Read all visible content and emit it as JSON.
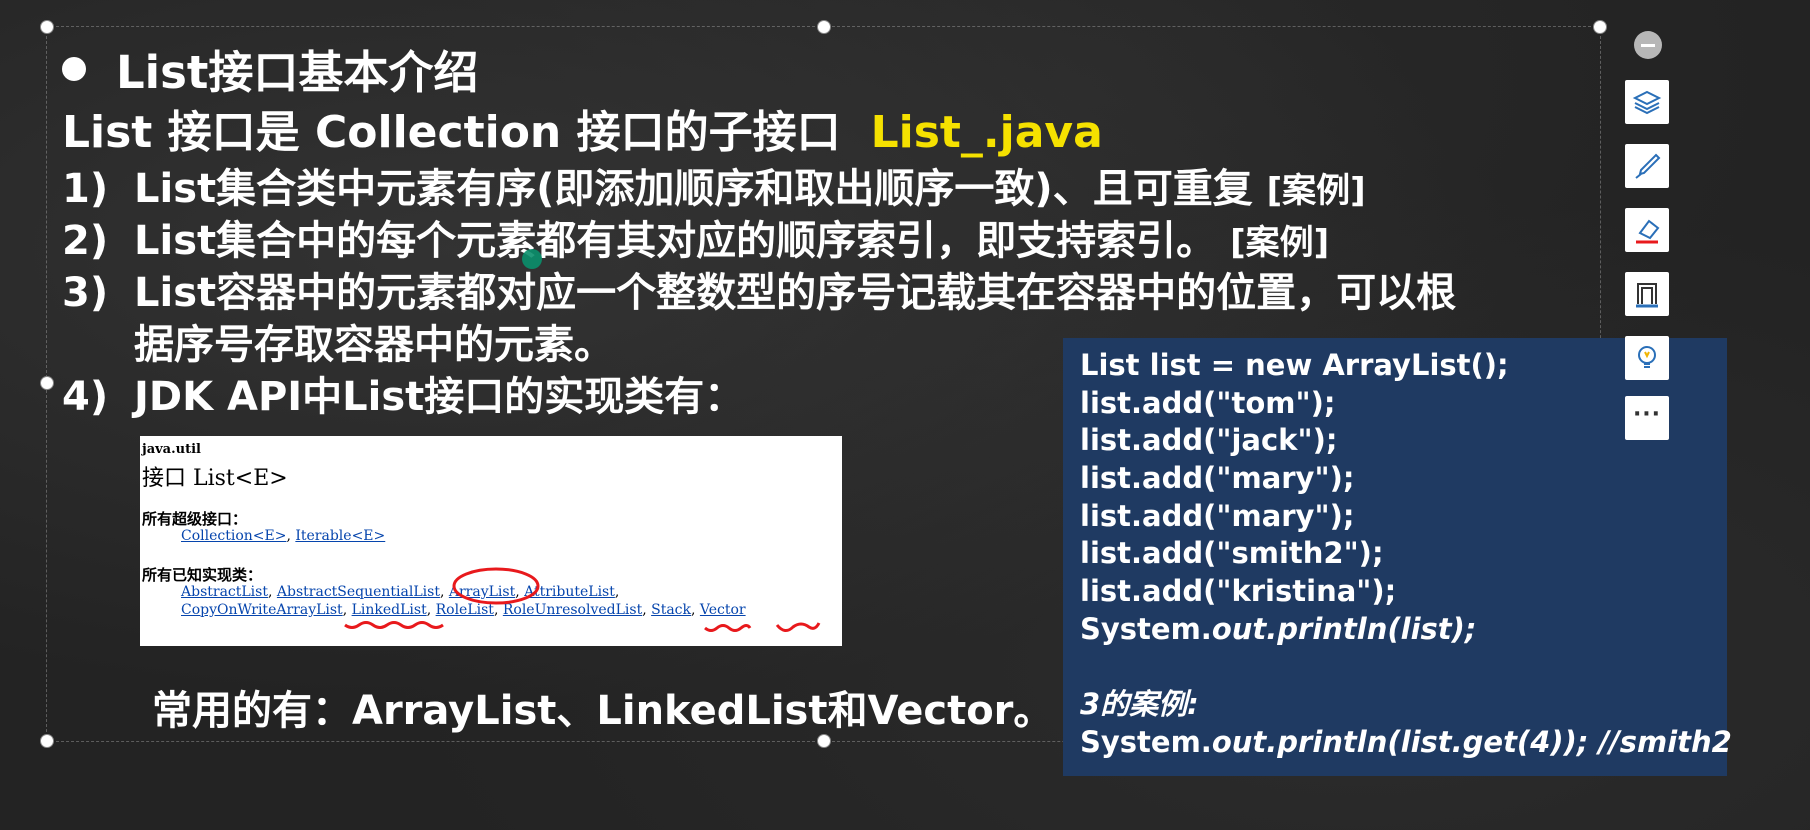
{
  "slide": {
    "title": "List接口基本介绍",
    "subtitle_main": "List 接口是 Collection 接口的子接口",
    "subtitle_highlight": "List_.java",
    "items": [
      {
        "num": "1)",
        "text": "List集合类中元素有序(即添加顺序和取出顺序一致)、且可重复",
        "tag": "[案例]"
      },
      {
        "num": "2)",
        "text": "List集合中的每个元素都有其对应的顺序索引，即支持索引。",
        "tag": "[案例]"
      },
      {
        "num": "3)",
        "text": "List容器中的元素都对应一个整数型的序号记载其在容器中的位置，可以根",
        "continuation": "据序号存取容器中的元素。"
      },
      {
        "num": "4)",
        "text": "JDK API中List接口的实现类有："
      }
    ],
    "common": "常用的有：ArrayList、LinkedList和Vector。"
  },
  "api_doc": {
    "package": "java.util",
    "interface": "接口 List<E>",
    "super_label": "所有超级接口：",
    "super_interfaces": [
      "Collection<E>",
      "Iterable<E>"
    ],
    "impl_label": "所有已知实现类：",
    "impl_row1": [
      "AbstractList",
      "AbstractSequentialList",
      "ArrayList",
      "AttributeList"
    ],
    "impl_row2": [
      "CopyOnWriteArrayList",
      "LinkedList",
      "RoleList",
      "RoleUnresolvedList",
      "Stack",
      "Vector"
    ],
    "annotation_color": "#e8191c"
  },
  "code": {
    "lines": [
      "List list = new ArrayList();",
      "list.add(\"tom\");",
      "list.add(\"jack\");",
      "list.add(\"mary\");",
      "list.add(\"mary\");",
      "list.add(\"smith2\");",
      "list.add(\"kristina\");"
    ],
    "print_prefix": "System.",
    "print_italic": "out.println(list);",
    "case_label": "3的案例:",
    "get_prefix": "System.",
    "get_italic": "out.println(list.get(4)); //smith2",
    "background": "#1f3a62"
  },
  "toolbar": {
    "icons": [
      "minimize-icon",
      "layers-icon",
      "pen-icon",
      "eraser-icon",
      "frame-icon",
      "lightbulb-icon",
      "more-icon"
    ],
    "more_label": "···"
  },
  "colors": {
    "highlight": "#f5e100",
    "background": "#232323"
  }
}
